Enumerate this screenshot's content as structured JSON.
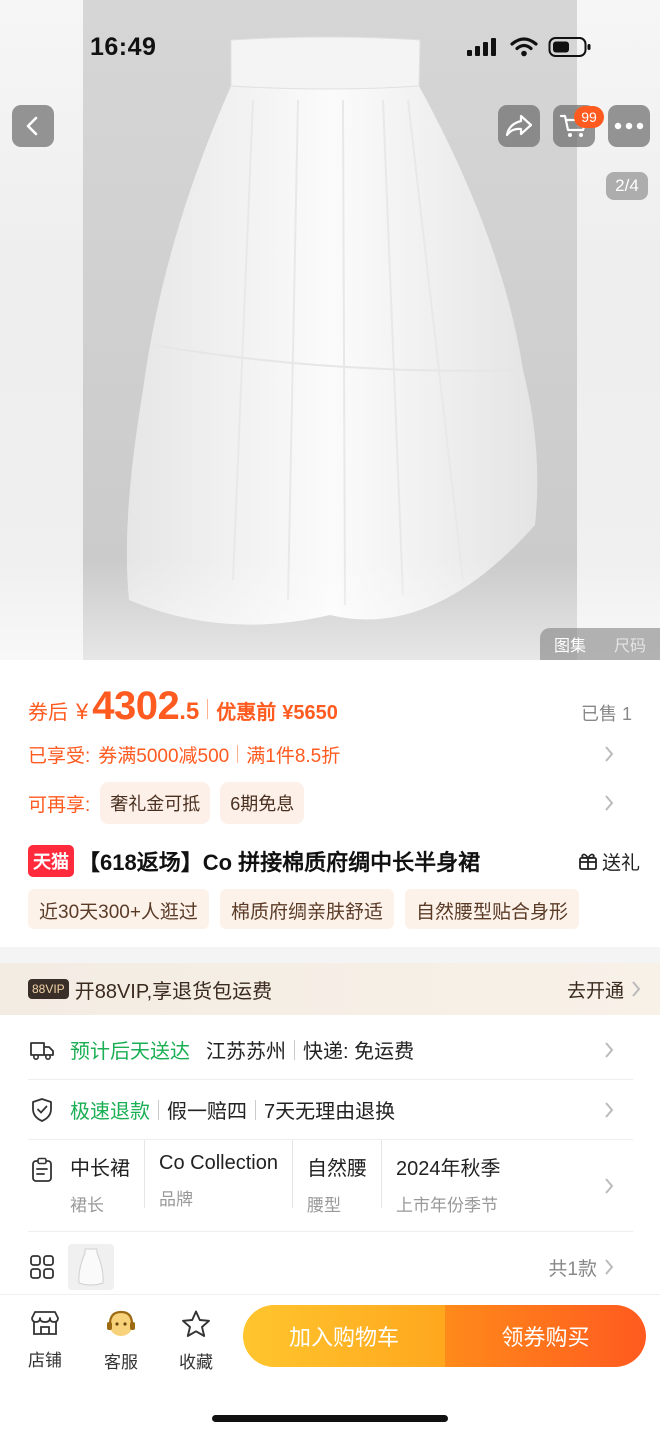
{
  "status_bar": {
    "time": "16:49"
  },
  "header": {
    "cart_badge": "99",
    "image_counter": "2/4"
  },
  "gallery": {
    "tabs": [
      "图集",
      "尺码"
    ]
  },
  "price": {
    "label": "券后",
    "currency": "¥",
    "integer": "4302",
    "decimal": ".5",
    "before_label": "优惠前",
    "before_value": "¥5650",
    "sold": "已售 1"
  },
  "promo": {
    "enjoyed_label": "已享受:",
    "enjoyed_items": [
      "券满5000减500",
      "满1件8.5折"
    ],
    "more_label": "可再享:",
    "more_items": [
      "奢礼金可抵",
      "6期免息"
    ]
  },
  "product": {
    "tmall_badge": "天猫",
    "title": "【618返场】Co 拼接棉质府绸中长半身裙",
    "gift_label": "送礼"
  },
  "tags": [
    "近30天300+人逛过",
    "棉质府绸亲肤舒适",
    "自然腰型贴合身形"
  ],
  "vip": {
    "badge": "88VIP",
    "text": "开88VIP,享退货包运费",
    "cta": "去开通"
  },
  "delivery": {
    "estimate": "预计后天送达",
    "origin": "江苏苏州",
    "shipping": "快递: 免运费"
  },
  "refund": {
    "fast": "极速退款",
    "items": [
      "假一赔四",
      "7天无理由退换"
    ]
  },
  "specs": [
    {
      "value": "中长裙",
      "key": "裙长"
    },
    {
      "value": "Co Collection",
      "key": "品牌"
    },
    {
      "value": "自然腰",
      "key": "腰型"
    },
    {
      "value": "2024年秋季",
      "key": "上市年份季节"
    }
  ],
  "styles": {
    "count": "共1款"
  },
  "bottom": {
    "tabs": [
      "店铺",
      "客服",
      "收藏"
    ],
    "add_cart": "加入购物车",
    "buy": "领券购买"
  },
  "colors": {
    "accent": "#ff5a1f",
    "tmall": "#ff2a3c",
    "green": "#1aaf54",
    "cart_button": "#ffb02a"
  }
}
